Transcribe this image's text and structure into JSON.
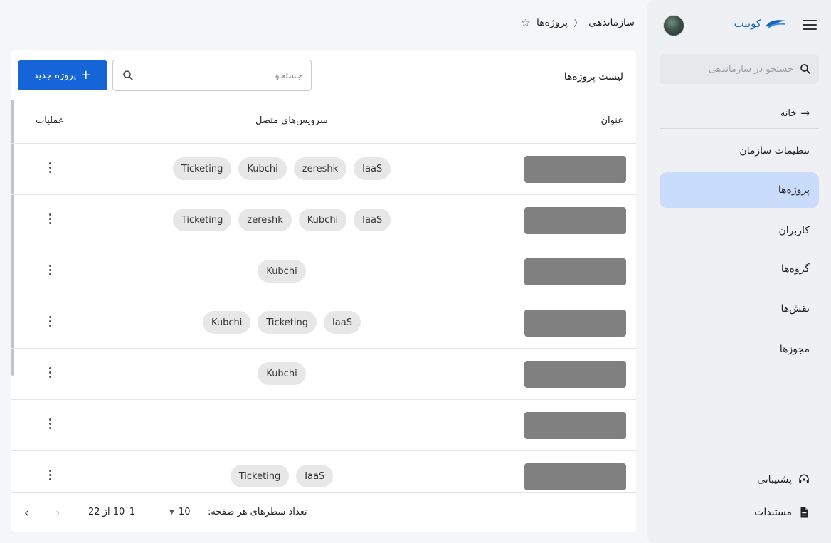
{
  "sidebar": {
    "brand": "کوبیت",
    "search_placeholder": "جستجو در سازماندهی",
    "home": "خانه",
    "items": [
      {
        "label": "تنظیمات سازمان"
      },
      {
        "label": "پروژه‌ها"
      },
      {
        "label": "کاربران"
      },
      {
        "label": "گروه‌ها"
      },
      {
        "label": "نقش‌ها"
      },
      {
        "label": "مجوزها"
      }
    ],
    "support": "پشتیبانی",
    "docs": "مستندات"
  },
  "breadcrumb": {
    "root": "سازماندهی",
    "current": "پروژه‌ها"
  },
  "card": {
    "title": "لیست پروژه‌ها",
    "search_placeholder": "جستجو",
    "new_button": "پروژه جدید"
  },
  "table": {
    "headers": {
      "title": "عنوان",
      "services": "سرویس‌های متصل",
      "ops": "عملیات"
    },
    "rows": [
      {
        "chips": [
          "IaaS",
          "zereshk",
          "Kubchi",
          "Ticketing"
        ]
      },
      {
        "chips": [
          "IaaS",
          "Kubchi",
          "zereshk",
          "Ticketing"
        ]
      },
      {
        "chips": [
          "Kubchi"
        ]
      },
      {
        "chips": [
          "IaaS",
          "Ticketing",
          "Kubchi"
        ]
      },
      {
        "chips": [
          "Kubchi"
        ]
      },
      {
        "chips": []
      },
      {
        "chips": [
          "IaaS",
          "Ticketing"
        ]
      }
    ]
  },
  "pagination": {
    "rows_per_page_label": "تعداد سطرهای هر صفحه:",
    "rows_per_page": "10",
    "range": "1–10 از 22"
  },
  "colors": {
    "primary": "#1565d8",
    "active_nav": "#c9dcfb",
    "brand": "#1565c0"
  }
}
